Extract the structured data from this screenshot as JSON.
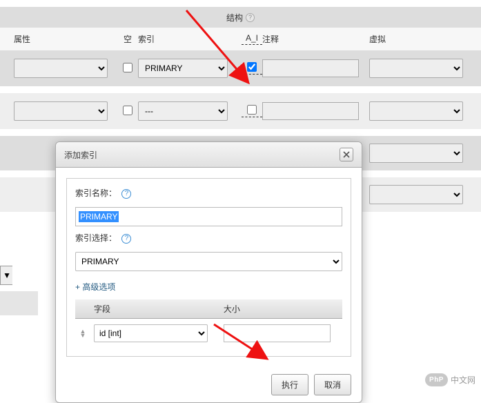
{
  "tab": {
    "label": "结构"
  },
  "headers": {
    "attribute": "属性",
    "null": "空",
    "index": "索引",
    "ai": "A_I",
    "comment": "注释",
    "virtual": "虚拟"
  },
  "rows": [
    {
      "attribute": "",
      "null_checked": false,
      "index": "PRIMARY",
      "ai_checked": true,
      "comment": "",
      "virtual": ""
    },
    {
      "attribute": "",
      "null_checked": false,
      "index": "---",
      "ai_checked": false,
      "comment": "",
      "virtual": ""
    },
    {
      "attribute": "",
      "null_checked": false,
      "index": "",
      "ai_checked": false,
      "comment": "",
      "virtual": ""
    }
  ],
  "modal": {
    "title": "添加索引",
    "index_name_label": "索引名称：",
    "index_name_value": "PRIMARY",
    "index_type_label": "索引选择：",
    "index_type_value": "PRIMARY",
    "advanced_link": "+ 高级选项",
    "col_field": "字段",
    "col_size": "大小",
    "field_value": "id [int]",
    "size_value": "",
    "execute": "执行",
    "cancel": "取消"
  },
  "watermark": {
    "icon": "PhP",
    "text": "中文网"
  }
}
